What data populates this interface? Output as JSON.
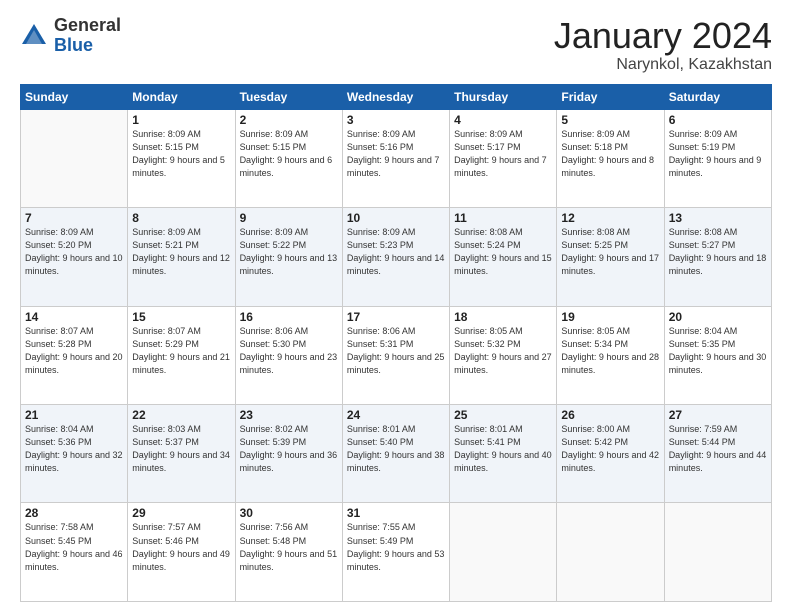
{
  "logo": {
    "general": "General",
    "blue": "Blue"
  },
  "header": {
    "month": "January 2024",
    "location": "Narynkol, Kazakhstan"
  },
  "days_of_week": [
    "Sunday",
    "Monday",
    "Tuesday",
    "Wednesday",
    "Thursday",
    "Friday",
    "Saturday"
  ],
  "weeks": [
    [
      {
        "day": null
      },
      {
        "day": 1,
        "sunrise": "Sunrise: 8:09 AM",
        "sunset": "Sunset: 5:15 PM",
        "daylight": "Daylight: 9 hours and 5 minutes."
      },
      {
        "day": 2,
        "sunrise": "Sunrise: 8:09 AM",
        "sunset": "Sunset: 5:15 PM",
        "daylight": "Daylight: 9 hours and 6 minutes."
      },
      {
        "day": 3,
        "sunrise": "Sunrise: 8:09 AM",
        "sunset": "Sunset: 5:16 PM",
        "daylight": "Daylight: 9 hours and 7 minutes."
      },
      {
        "day": 4,
        "sunrise": "Sunrise: 8:09 AM",
        "sunset": "Sunset: 5:17 PM",
        "daylight": "Daylight: 9 hours and 7 minutes."
      },
      {
        "day": 5,
        "sunrise": "Sunrise: 8:09 AM",
        "sunset": "Sunset: 5:18 PM",
        "daylight": "Daylight: 9 hours and 8 minutes."
      },
      {
        "day": 6,
        "sunrise": "Sunrise: 8:09 AM",
        "sunset": "Sunset: 5:19 PM",
        "daylight": "Daylight: 9 hours and 9 minutes."
      }
    ],
    [
      {
        "day": 7,
        "sunrise": "Sunrise: 8:09 AM",
        "sunset": "Sunset: 5:20 PM",
        "daylight": "Daylight: 9 hours and 10 minutes."
      },
      {
        "day": 8,
        "sunrise": "Sunrise: 8:09 AM",
        "sunset": "Sunset: 5:21 PM",
        "daylight": "Daylight: 9 hours and 12 minutes."
      },
      {
        "day": 9,
        "sunrise": "Sunrise: 8:09 AM",
        "sunset": "Sunset: 5:22 PM",
        "daylight": "Daylight: 9 hours and 13 minutes."
      },
      {
        "day": 10,
        "sunrise": "Sunrise: 8:09 AM",
        "sunset": "Sunset: 5:23 PM",
        "daylight": "Daylight: 9 hours and 14 minutes."
      },
      {
        "day": 11,
        "sunrise": "Sunrise: 8:08 AM",
        "sunset": "Sunset: 5:24 PM",
        "daylight": "Daylight: 9 hours and 15 minutes."
      },
      {
        "day": 12,
        "sunrise": "Sunrise: 8:08 AM",
        "sunset": "Sunset: 5:25 PM",
        "daylight": "Daylight: 9 hours and 17 minutes."
      },
      {
        "day": 13,
        "sunrise": "Sunrise: 8:08 AM",
        "sunset": "Sunset: 5:27 PM",
        "daylight": "Daylight: 9 hours and 18 minutes."
      }
    ],
    [
      {
        "day": 14,
        "sunrise": "Sunrise: 8:07 AM",
        "sunset": "Sunset: 5:28 PM",
        "daylight": "Daylight: 9 hours and 20 minutes."
      },
      {
        "day": 15,
        "sunrise": "Sunrise: 8:07 AM",
        "sunset": "Sunset: 5:29 PM",
        "daylight": "Daylight: 9 hours and 21 minutes."
      },
      {
        "day": 16,
        "sunrise": "Sunrise: 8:06 AM",
        "sunset": "Sunset: 5:30 PM",
        "daylight": "Daylight: 9 hours and 23 minutes."
      },
      {
        "day": 17,
        "sunrise": "Sunrise: 8:06 AM",
        "sunset": "Sunset: 5:31 PM",
        "daylight": "Daylight: 9 hours and 25 minutes."
      },
      {
        "day": 18,
        "sunrise": "Sunrise: 8:05 AM",
        "sunset": "Sunset: 5:32 PM",
        "daylight": "Daylight: 9 hours and 27 minutes."
      },
      {
        "day": 19,
        "sunrise": "Sunrise: 8:05 AM",
        "sunset": "Sunset: 5:34 PM",
        "daylight": "Daylight: 9 hours and 28 minutes."
      },
      {
        "day": 20,
        "sunrise": "Sunrise: 8:04 AM",
        "sunset": "Sunset: 5:35 PM",
        "daylight": "Daylight: 9 hours and 30 minutes."
      }
    ],
    [
      {
        "day": 21,
        "sunrise": "Sunrise: 8:04 AM",
        "sunset": "Sunset: 5:36 PM",
        "daylight": "Daylight: 9 hours and 32 minutes."
      },
      {
        "day": 22,
        "sunrise": "Sunrise: 8:03 AM",
        "sunset": "Sunset: 5:37 PM",
        "daylight": "Daylight: 9 hours and 34 minutes."
      },
      {
        "day": 23,
        "sunrise": "Sunrise: 8:02 AM",
        "sunset": "Sunset: 5:39 PM",
        "daylight": "Daylight: 9 hours and 36 minutes."
      },
      {
        "day": 24,
        "sunrise": "Sunrise: 8:01 AM",
        "sunset": "Sunset: 5:40 PM",
        "daylight": "Daylight: 9 hours and 38 minutes."
      },
      {
        "day": 25,
        "sunrise": "Sunrise: 8:01 AM",
        "sunset": "Sunset: 5:41 PM",
        "daylight": "Daylight: 9 hours and 40 minutes."
      },
      {
        "day": 26,
        "sunrise": "Sunrise: 8:00 AM",
        "sunset": "Sunset: 5:42 PM",
        "daylight": "Daylight: 9 hours and 42 minutes."
      },
      {
        "day": 27,
        "sunrise": "Sunrise: 7:59 AM",
        "sunset": "Sunset: 5:44 PM",
        "daylight": "Daylight: 9 hours and 44 minutes."
      }
    ],
    [
      {
        "day": 28,
        "sunrise": "Sunrise: 7:58 AM",
        "sunset": "Sunset: 5:45 PM",
        "daylight": "Daylight: 9 hours and 46 minutes."
      },
      {
        "day": 29,
        "sunrise": "Sunrise: 7:57 AM",
        "sunset": "Sunset: 5:46 PM",
        "daylight": "Daylight: 9 hours and 49 minutes."
      },
      {
        "day": 30,
        "sunrise": "Sunrise: 7:56 AM",
        "sunset": "Sunset: 5:48 PM",
        "daylight": "Daylight: 9 hours and 51 minutes."
      },
      {
        "day": 31,
        "sunrise": "Sunrise: 7:55 AM",
        "sunset": "Sunset: 5:49 PM",
        "daylight": "Daylight: 9 hours and 53 minutes."
      },
      {
        "day": null
      },
      {
        "day": null
      },
      {
        "day": null
      }
    ]
  ]
}
